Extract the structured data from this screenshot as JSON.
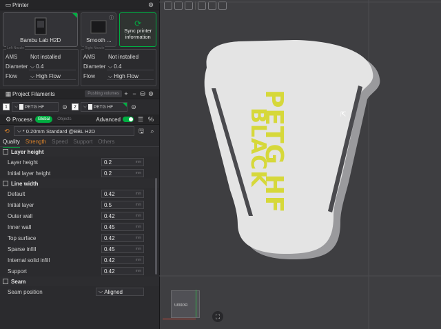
{
  "printer": {
    "title": "Printer",
    "selected_name": "Bambu Lab H2D",
    "other_name": "Smooth ...",
    "sync_label_1": "Sync printer",
    "sync_label_2": "information",
    "left": {
      "ams_label": "AMS",
      "ams_value": "Not installed",
      "diameter_label": "Diameter",
      "diameter_value": "0.4",
      "flow_label": "Flow",
      "flow_value": "High Flow"
    },
    "right": {
      "ams_label": "AMS",
      "ams_value": "Not installed",
      "diameter_label": "Diameter",
      "diameter_value": "0.4",
      "flow_label": "Flow",
      "flow_value": "High Flow"
    }
  },
  "filaments": {
    "title": "Project Filaments",
    "pushing_label": "Pushing volumes",
    "slots": [
      {
        "num": "1",
        "name": "PETG HF",
        "color": "#f0f0f0"
      },
      {
        "num": "2",
        "name": "PETG HF",
        "color": "#f0f0f0"
      }
    ]
  },
  "process": {
    "title": "Process",
    "mode_global": "Global",
    "mode_objects": "Objects",
    "advanced_label": "Advanced",
    "preset": "* 0.20mm Standard @BBL H2D",
    "tabs": [
      "Quality",
      "Strength",
      "Speed",
      "Support",
      "Others"
    ],
    "groups": [
      {
        "title": "Layer height",
        "rows": [
          {
            "label": "Layer height",
            "value": "0.2",
            "unit": "mm"
          },
          {
            "label": "Initial layer height",
            "value": "0.2",
            "unit": "mm"
          }
        ]
      },
      {
        "title": "Line width",
        "rows": [
          {
            "label": "Default",
            "value": "0.42",
            "unit": "mm"
          },
          {
            "label": "Initial layer",
            "value": "0.5",
            "unit": "mm"
          },
          {
            "label": "Outer wall",
            "value": "0.42",
            "unit": "mm"
          },
          {
            "label": "Inner wall",
            "value": "0.45",
            "unit": "mm"
          },
          {
            "label": "Top surface",
            "value": "0.42",
            "unit": "mm"
          },
          {
            "label": "Sparse infill",
            "value": "0.45",
            "unit": "mm"
          },
          {
            "label": "Internal solid infill",
            "value": "0.42",
            "unit": "mm"
          },
          {
            "label": "Support",
            "value": "0.42",
            "unit": "mm"
          }
        ]
      },
      {
        "title": "Seam",
        "rows": [
          {
            "label": "Seam position",
            "value": "Aligned",
            "unit": ""
          }
        ]
      }
    ]
  },
  "viewport": {
    "text_line1": "PETG HF",
    "text_line2": "BLACK",
    "text_color": "#d6d83a",
    "model_color": "#e4e4e4",
    "cube_label": "Bottom",
    "accent": "#00ae42"
  }
}
